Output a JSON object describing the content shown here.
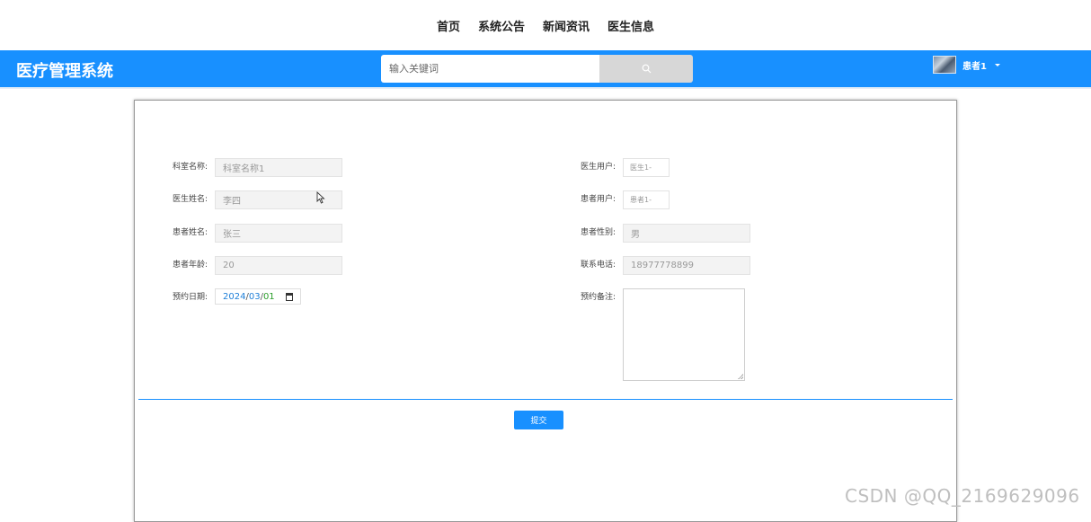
{
  "nav": {
    "items": [
      {
        "label": "首页"
      },
      {
        "label": "系统公告"
      },
      {
        "label": "新闻资讯"
      },
      {
        "label": "医生信息"
      }
    ]
  },
  "header": {
    "title": "医疗管理系统",
    "search_placeholder": "输入关键词",
    "search_icon": "search-icon",
    "username": "患者1",
    "accent_color": "#1890ff"
  },
  "form": {
    "department_label": "科室名称:",
    "department_value": "科室名称1",
    "doctor_name_label": "医生姓名:",
    "doctor_name_value": "李四",
    "patient_name_label": "患者姓名:",
    "patient_name_value": "张三",
    "patient_age_label": "患者年龄:",
    "patient_age_value": "20",
    "date_label": "预约日期:",
    "date_year": "2024",
    "date_month": "03",
    "date_day": "01",
    "date_sep": "/",
    "doctor_user_label": "医生用户:",
    "doctor_user_value": "医生1-",
    "patient_user_label": "患者用户:",
    "patient_user_value": "患者1-",
    "patient_gender_label": "患者性别:",
    "patient_gender_value": "男",
    "phone_label": "联系电话:",
    "phone_value": "18977778899",
    "note_label": "预约备注:",
    "note_value": "",
    "submit_label": "提交"
  },
  "watermark": "CSDN @QQ_2169629096"
}
